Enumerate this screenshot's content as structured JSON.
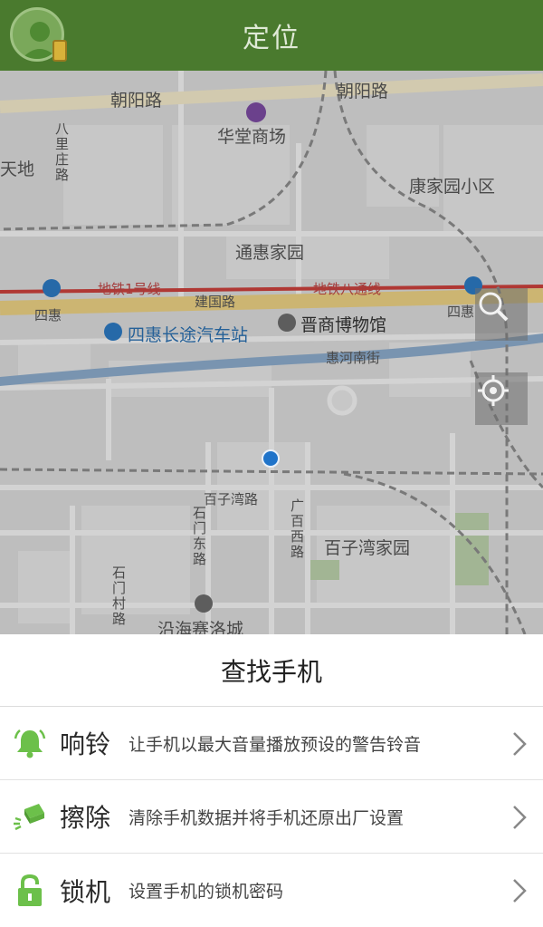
{
  "header": {
    "title": "定位"
  },
  "map": {
    "labels": {
      "chaoyang_road_1": "朝阳路",
      "chaoyang_road_2": "朝阳路",
      "huatang_mall": "华堂商场",
      "tiandi": "天地",
      "balizhuang_road": "八里庄路",
      "kangjiayuan": "康家园小区",
      "tonghui_jiayuan": "通惠家园",
      "subway_line1": "地铁1号线",
      "subway_batong": "地铁八通线",
      "jianguo_road": "建国路",
      "sihui_station_west": "四惠",
      "sihui_station_east": "四惠",
      "sihui_bus_station": "四惠长途汽车站",
      "jinshang_museum": "晋商博物馆",
      "huihe_south_street": "惠河南街",
      "baiziwan_road": "百子湾路",
      "shimen_east_road": "石门东路",
      "guangbai_west_road": "广百西路",
      "baiziwan_jiayuan": "百子湾家园",
      "shimen_village_road": "石门村路",
      "yanhai_saile_city": "沿海赛洛城"
    }
  },
  "panel": {
    "title": "查找手机",
    "rows": [
      {
        "label": "响铃",
        "desc": "让手机以最大音量播放预设的警告铃音",
        "icon": "bell-icon"
      },
      {
        "label": "擦除",
        "desc": "清除手机数据并将手机还原出厂设置",
        "icon": "eraser-icon"
      },
      {
        "label": "锁机",
        "desc": "设置手机的锁机密码",
        "icon": "lock-icon"
      }
    ]
  },
  "colors": {
    "header": "#4a7a2e",
    "accent_green": "#6cc04a",
    "location_dot": "#1f73c9"
  }
}
